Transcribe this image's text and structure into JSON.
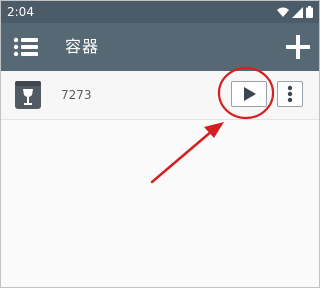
{
  "status_bar": {
    "time": "2:04",
    "icons": [
      "wifi-icon",
      "signal-icon",
      "battery-icon"
    ]
  },
  "app_bar": {
    "title": "容器",
    "menu_icon": "list-menu-icon",
    "add_icon": "plus-icon"
  },
  "containers": [
    {
      "name": "7273",
      "icon": "wine-glass-box-icon",
      "actions": [
        "play-icon",
        "more-vert-icon"
      ]
    }
  ],
  "annotations": {
    "highlight_color": "#d42020"
  },
  "colors": {
    "status_bar": "#4b5b67",
    "app_bar": "#566874",
    "list_background": "#f7f7f7"
  }
}
